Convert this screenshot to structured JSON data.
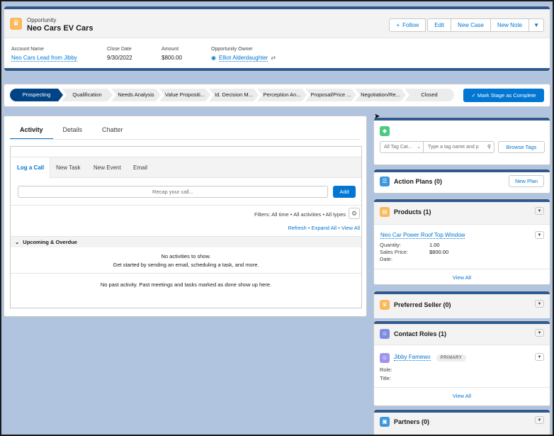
{
  "header": {
    "object_type": "Opportunity",
    "record_name": "Neo Cars EV Cars",
    "buttons": {
      "follow": "Follow",
      "edit": "Edit",
      "new_case": "New Case",
      "new_note": "New Note"
    },
    "fields": [
      {
        "label": "Account Name",
        "value": "Neo Cars Lead from Jibby"
      },
      {
        "label": "Close Date",
        "value": "9/30/2022"
      },
      {
        "label": "Amount",
        "value": "$800.00"
      },
      {
        "label": "Opportunity Owner",
        "value": "Elliot Alderdaughter"
      }
    ]
  },
  "path": {
    "stages": [
      "Prospecting",
      "Qualification",
      "Needs Analysis",
      "Value Propositi...",
      "Id. Decision M...",
      "Perception An...",
      "Proposal/Price ...",
      "Negotiation/Re...",
      "Closed"
    ],
    "current": "Prospecting",
    "mark_button": "Mark Stage as Complete"
  },
  "activity": {
    "tabs": [
      "Activity",
      "Details",
      "Chatter"
    ],
    "subtabs": [
      "Log a Call",
      "New Task",
      "New Event",
      "Email"
    ],
    "recap_placeholder": "Recap your call...",
    "add_label": "Add",
    "filters": "Filters: All time • All activities • All types",
    "links": {
      "refresh": "Refresh",
      "expand": "Expand All",
      "view": "View All"
    },
    "upcoming_label": "Upcoming & Overdue",
    "no_activities": "No activities to show.",
    "get_started": "Get started by sending an email, scheduling a task, and more.",
    "no_past": "No past activity. Past meetings and tasks marked as done show up here."
  },
  "tags": {
    "category_placeholder": "All Tag Cat...",
    "search_placeholder": "Type a tag name and p",
    "browse_label": "Browse Tags"
  },
  "action_plans": {
    "title": "Action Plans (0)",
    "new_plan": "New Plan"
  },
  "products": {
    "title": "Products (1)",
    "item_name": "Neo Car Power Roof Top Window",
    "quantity_label": "Quantity:",
    "quantity": "1.00",
    "price_label": "Sales Price:",
    "price": "$800.00",
    "date_label": "Date:",
    "view_all": "View All"
  },
  "preferred_seller": {
    "title": "Preferred Seller (0)"
  },
  "contact_roles": {
    "title": "Contact Roles (1)",
    "contact": "Jibby Famewo",
    "badge": "PRIMARY",
    "role_label": "Role:",
    "title_label": "Title:",
    "view_all": "View All"
  },
  "partners": {
    "title": "Partners (0)"
  },
  "colors": {
    "brand": "#0176d3",
    "path_active": "#014486",
    "stripe": "#2f5a8f",
    "bg": "#b0c4df"
  }
}
